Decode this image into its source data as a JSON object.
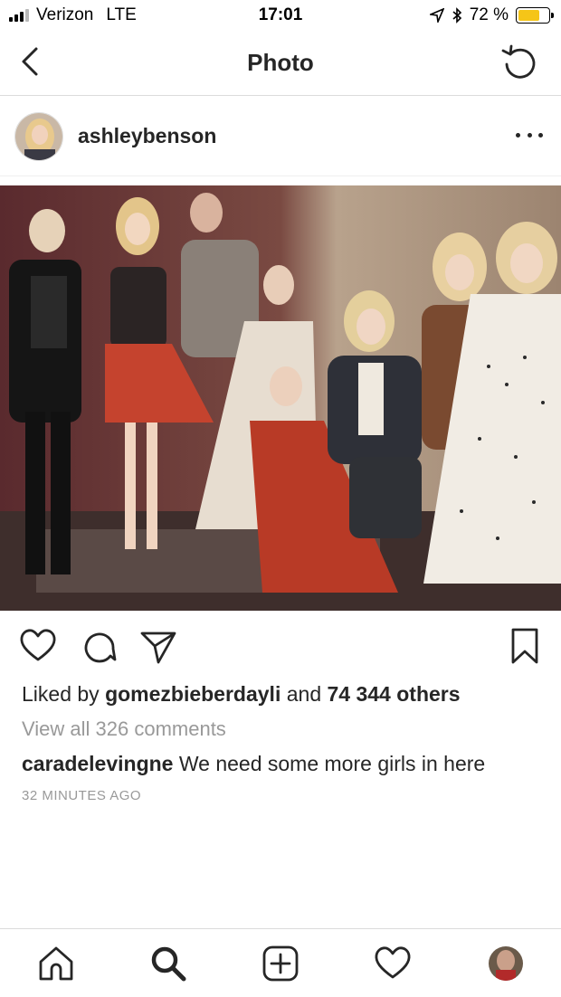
{
  "status_bar": {
    "carrier": "Verizon",
    "network": "LTE",
    "time": "17:01",
    "battery_percent": "72 %",
    "battery_level": 0.72,
    "battery_color": "#f5c518",
    "icons": [
      "location-arrow-icon",
      "bluetooth-icon"
    ]
  },
  "nav": {
    "title": "Photo",
    "back_icon": "chevron-left-icon",
    "refresh_icon": "refresh-icon"
  },
  "post": {
    "username": "ashleybenson",
    "more_icon": "ellipsis-icon",
    "photo_icon": "group-photo"
  },
  "actions": {
    "icons": [
      "heart-icon",
      "comment-icon",
      "share-icon",
      "bookmark-icon"
    ]
  },
  "likes": {
    "prefix": "Liked by ",
    "user": "gomezbieberdayli",
    "middle": " and ",
    "count": "74 344 others"
  },
  "comments": {
    "view_all": "View all 326 comments",
    "author": "caradelevingne",
    "text": " We need some more girls in here"
  },
  "timestamp": "32 MINUTES AGO",
  "tab_bar": {
    "icons": [
      "home-icon",
      "search-icon",
      "add-post-icon",
      "activity-heart-icon",
      "profile-avatar"
    ]
  }
}
